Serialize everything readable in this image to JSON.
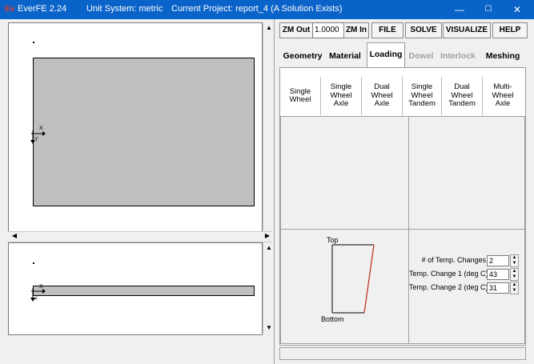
{
  "titlebar": {
    "app": "EverFE 2.24",
    "unit_system": "Unit System: metric",
    "project": "Current Project: report_4 (A Solution Exists)",
    "logo": "Ev",
    "min_icon": "—",
    "max_icon": "☐",
    "close_icon": "✕"
  },
  "toolbar": {
    "zoom_out": "ZM Out",
    "zoom_value": "1.0000",
    "zoom_in": "ZM In",
    "file": "FILE",
    "solve": "SOLVE",
    "visualize": "VISUALIZE",
    "help": "HELP"
  },
  "tabs": [
    {
      "label": "Geometry",
      "state": "normal"
    },
    {
      "label": "Material",
      "state": "normal"
    },
    {
      "label": "Loading",
      "state": "active"
    },
    {
      "label": "Dowel",
      "state": "disabled"
    },
    {
      "label": "Interlock",
      "state": "disabled"
    },
    {
      "label": "Meshing",
      "state": "normal"
    }
  ],
  "load_types": [
    {
      "line1": "Single",
      "line2": "Wheel",
      "line3": ""
    },
    {
      "line1": "Single",
      "line2": "Wheel",
      "line3": "Axle"
    },
    {
      "line1": "Dual",
      "line2": "Wheel",
      "line3": "Axle"
    },
    {
      "line1": "Single",
      "line2": "Wheel",
      "line3": "Tandem"
    },
    {
      "line1": "Dual",
      "line2": "Wheel",
      "line3": "Tandem"
    },
    {
      "line1": "Multi-",
      "line2": "Wheel",
      "line3": "Axle"
    }
  ],
  "plan_view": {
    "axis_x": "X",
    "axis_y": "Y"
  },
  "section_view": {
    "axis_x": "X",
    "axis_z": "Z"
  },
  "temperature": {
    "top_label": "Top",
    "bottom_label": "Bottom",
    "num_changes_label": "# of Temp. Changes",
    "num_changes_value": "2",
    "change1_label": "Temp. Change 1 (deg C)",
    "change1_value": "43",
    "change2_label": "Temp. Change 2 (deg C)",
    "change2_value": "31"
  },
  "colors": {
    "titlebar": "#0a63c9",
    "slab": "#bfbfbf",
    "gradient_line": "#c0392b"
  }
}
